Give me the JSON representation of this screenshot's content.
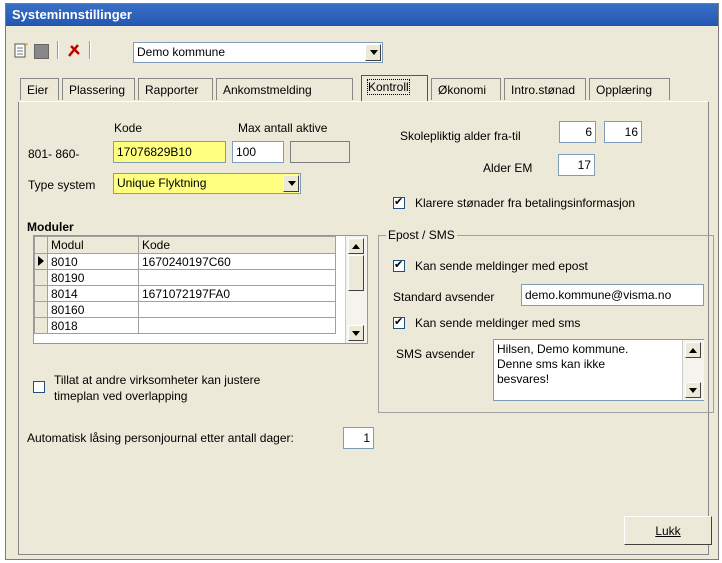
{
  "window": {
    "title": "Systeminnstillinger"
  },
  "toolbar": {
    "new_icon": "new-document-icon",
    "save_icon": "save-icon",
    "delete_icon": "delete-icon",
    "organization": "Demo kommune"
  },
  "tabs": [
    "Eier",
    "Plassering",
    "Rapporter",
    "Ankomstmelding",
    "Kontroll",
    "Økonomi",
    "Intro.stønad",
    "Opplæring"
  ],
  "active_tab": "Kontroll",
  "kontroll": {
    "range_label": "801- 860-",
    "kode_label": "Kode",
    "kode_value": "17076829B10",
    "max_label": "Max antall aktive",
    "max_value": "100",
    "type_system_label": "Type system",
    "type_system_value": "Unique Flyktning",
    "moduler_title": "Moduler",
    "moduler_headers": [
      "Modul",
      "Kode"
    ],
    "moduler_rows": [
      {
        "modul": "8010",
        "kode": "1670240197C60"
      },
      {
        "modul": "80190",
        "kode": ""
      },
      {
        "modul": "8014",
        "kode": "1671072197FA0"
      },
      {
        "modul": "80160",
        "kode": ""
      },
      {
        "modul": "8018",
        "kode": ""
      }
    ],
    "tillat_line1": "Tillat at andre virksomheter kan justere",
    "tillat_line2": "timeplan ved overlapping",
    "auto_lock_label": "Automatisk låsing personjournal etter antall dager:",
    "auto_lock_value": "1",
    "skolepliktig_label": "Skolepliktig alder fra-til",
    "skolepliktig_from": "6",
    "skolepliktig_to": "16",
    "alder_em_label": "Alder EM",
    "alder_em_value": "17",
    "klarere_label": "Klarere stønader fra betalingsinformasjon",
    "epost_group": {
      "title": "Epost / SMS",
      "kan_sende_epost": "Kan sende meldinger med epost",
      "standard_avsender_label": "Standard avsender",
      "standard_avsender_value": "demo.kommune@visma.no",
      "kan_sende_sms": "Kan sende meldinger med sms",
      "sms_avsender_label": "SMS avsender",
      "sms_lines": [
        "Hilsen, Demo kommune.",
        "Denne sms kan ikke",
        "besvares!"
      ]
    }
  },
  "buttons": {
    "close": "Lukk"
  }
}
